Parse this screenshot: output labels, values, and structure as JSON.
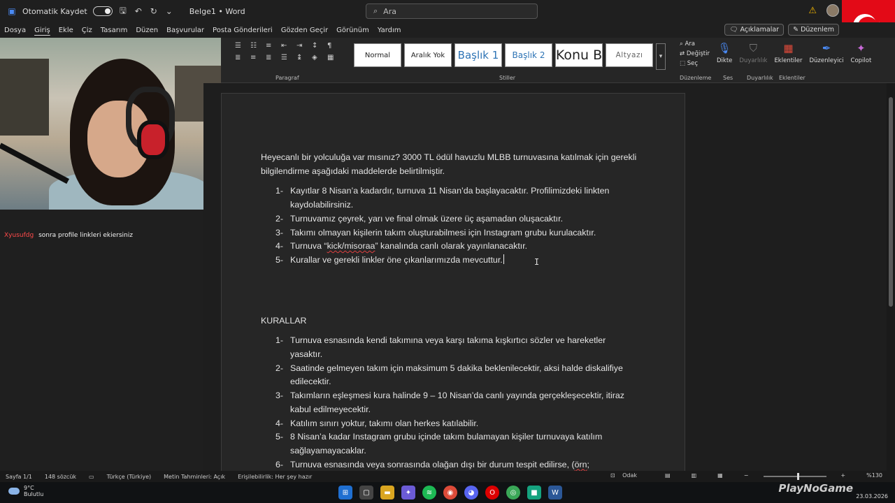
{
  "titlebar": {
    "autosave_label": "Otomatik Kaydet",
    "doc_title": "Belge1 • Word",
    "search_placeholder": "Ara"
  },
  "menu": {
    "tabs": [
      "Dosya",
      "Giriş",
      "Ekle",
      "Çiz",
      "Tasarım",
      "Düzen",
      "Başvurular",
      "Posta Gönderileri",
      "Gözden Geçir",
      "Görünüm",
      "Yardım"
    ],
    "comments_label": "Açıklamalar",
    "editing_label": "Düzenlem"
  },
  "ribbon": {
    "paragraph_label": "Paragraf",
    "styles_label": "Stiller",
    "styles": [
      "Normal",
      "Aralık Yok",
      "Başlık 1",
      "Başlık 2",
      "Konu B",
      "Altyazı"
    ],
    "find_label": "Ara",
    "replace_label": "Değiştir",
    "select_label": "Seç",
    "editing_group": "Düzenleme",
    "dictate": "Dikte",
    "voice_group": "Ses",
    "sensitivity": "Duyarlılık",
    "sensitivity_group": "Duyarlılık",
    "addins": "Eklentiler",
    "addins_group": "Eklentiler",
    "editor": "Düzenleyici",
    "copilot": "Copilot"
  },
  "chat": {
    "user": "Xyusufdg",
    "message": "sonra profile linkleri ekiersiniz"
  },
  "document": {
    "intro": "Heyecanlı bir yolculuğa var mısınız? 3000 TL ödül havuzlu MLBB turnuvasına katılmak için gerekli bilgilendirme aşağıdaki maddelerde belirtilmiştir.",
    "items": [
      {
        "num": "1-",
        "text": "Kayıtlar 8 Nisan’a kadardır, turnuva 11 Nisan’da başlayacaktır. Profilimizdeki linkten kaydolabilirsiniz."
      },
      {
        "num": "2-",
        "text": "Turnuvamız çeyrek, yarı ve final olmak üzere üç aşamadan oluşacaktır."
      },
      {
        "num": "3-",
        "text": "Takımı olmayan kişilerin takım oluşturabilmesi için Instagram grubu kurulacaktır."
      },
      {
        "num": "4-",
        "pre": "Turnuva “",
        "spell": "kick/misoraa",
        "post": "” kanalında canlı olarak yayınlanacaktır."
      },
      {
        "num": "5-",
        "text": "Kurallar ve gerekli linkler öne çıkanlarımızda mevcuttur."
      }
    ],
    "rules_heading": "KURALLAR",
    "rules": [
      {
        "num": "1-",
        "text": "Turnuva esnasında kendi takımına veya karşı takıma kışkırtıcı sözler ve hareketler yasaktır."
      },
      {
        "num": "2-",
        "text": "Saatinde gelmeyen takım için maksimum 5 dakika beklenilecektir, aksi halde diskalifiye edilecektir."
      },
      {
        "num": "3-",
        "text": "Takımların eşleşmesi kura halinde 9 – 10 Nisan’da canlı yayında gerçekleşecektir, itiraz kabul edilmeyecektir."
      },
      {
        "num": "4-",
        "text": "Katılım sınırı yoktur, takımı olan herkes katılabilir."
      },
      {
        "num": "5-",
        "text": "8 Nisan’a kadar Instagram grubu içinde takım bulamayan kişiler turnuvaya katılım sağlayamayacaklar."
      },
      {
        "num": "6-",
        "pre": "Turnuva esnasında veya sonrasında olağan dışı bir durum tespit edilirse, (",
        "spell": "örn",
        "post": ";"
      }
    ]
  },
  "status": {
    "page": "Sayfa 1/1",
    "words": "148 sözcük",
    "language": "Türkçe (Türkiye)",
    "predictions": "Metin Tahminleri: Açık",
    "accessibility": "Erişilebilirlik: Her şey hazır",
    "focus": "Odak",
    "zoom": "%130"
  },
  "taskbar": {
    "temp": "9°C",
    "weather": "Bulutlu",
    "date": "23.03.2026",
    "watermark": "PlayNoGame"
  },
  "colors": {
    "flag_red": "#e30a17",
    "chat_user": "#ff4a4a",
    "heading_blue": "#2e74b5"
  }
}
